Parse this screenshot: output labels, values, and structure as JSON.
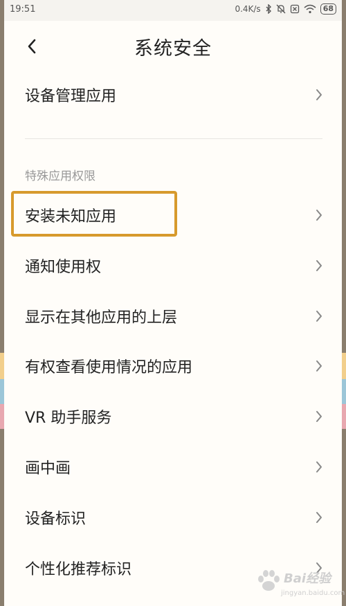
{
  "status_bar": {
    "time": "19:51",
    "speed": "0.4K/s",
    "battery": "68"
  },
  "header": {
    "title": "系统安全"
  },
  "top_items": [
    {
      "label": "设备管理应用"
    }
  ],
  "section": {
    "header": "特殊应用权限"
  },
  "items": [
    {
      "label": "安装未知应用"
    },
    {
      "label": "通知使用权"
    },
    {
      "label": "显示在其他应用的上层"
    },
    {
      "label": "有权查看使用情况的应用"
    },
    {
      "label": "VR 助手服务"
    },
    {
      "label": "画中画"
    },
    {
      "label": "设备标识"
    },
    {
      "label": "个性化推荐标识"
    }
  ],
  "watermark": {
    "brand": "Bai经验",
    "url": "jingyan.baidu.com"
  },
  "colors": {
    "highlight_border": "#d79a2d",
    "background": "#fffdf9",
    "text_primary": "#222222",
    "text_secondary": "#999999"
  }
}
